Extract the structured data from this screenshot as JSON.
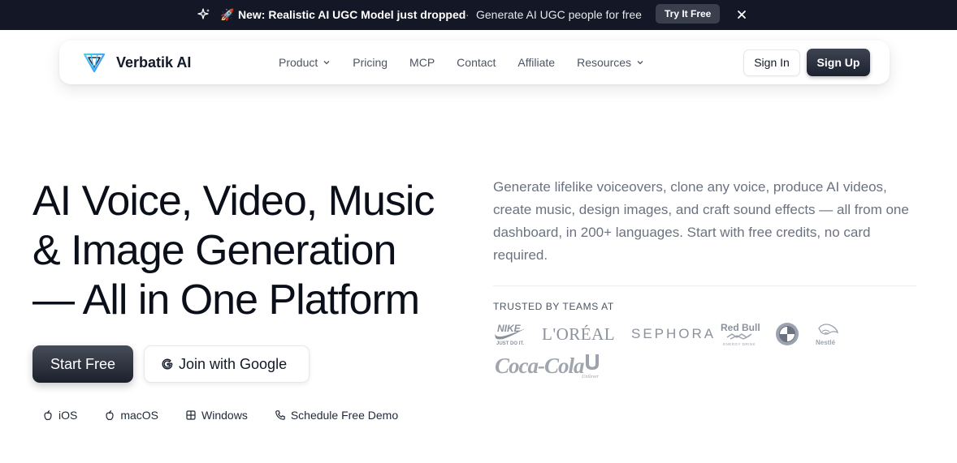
{
  "announcement": {
    "headline": "New: Realistic AI UGC Model just dropped",
    "separator": "·",
    "subtext": "Generate AI UGC people for free",
    "cta": "Try It Free",
    "rocket_emoji": "🚀",
    "icons": [
      "sparkle-icon",
      "rocket-icon",
      "close-icon"
    ]
  },
  "nav": {
    "brand": "Verbatik AI",
    "links": [
      {
        "label": "Product",
        "dropdown": true
      },
      {
        "label": "Pricing",
        "dropdown": false
      },
      {
        "label": "MCP",
        "dropdown": false
      },
      {
        "label": "Contact",
        "dropdown": false
      },
      {
        "label": "Affiliate",
        "dropdown": false
      },
      {
        "label": "Resources",
        "dropdown": true
      }
    ],
    "sign_in": "Sign In",
    "sign_up": "Sign Up"
  },
  "hero": {
    "title_lines": [
      "AI Voice, Video, Music",
      "& Image Generation",
      "— All in One Platform"
    ],
    "start_button": "Start Free",
    "google_button": "Join with Google",
    "platforms": {
      "ios": "iOS",
      "macos": "macOS",
      "windows": "Windows",
      "demo": "Schedule Free Demo"
    },
    "description": "Generate lifelike voiceovers, clone any voice, produce AI videos, create music, design images, and craft sound effects — all from one dashboard, in 200+ languages. Start with free credits, no card required.",
    "trusted_label": "TRUSTED BY TEAMS AT",
    "logos": {
      "nike": "NIKE",
      "nike_tag": "JUST DO IT.",
      "loreal": "L'ORÉAL",
      "sephora": "SEPHORA",
      "redbull": "Red Bull",
      "redbull_tag": "ENERGY DRINK",
      "bmw": "BMW",
      "nestle": "Nestlé",
      "cocacola": "Coca-Cola",
      "unilever": "Unilever"
    }
  },
  "colors": {
    "announcement_bg": "#141826",
    "primary_button": "#1d2230",
    "muted_text": "#6b7280",
    "logo_gray": "#9ca3af"
  }
}
